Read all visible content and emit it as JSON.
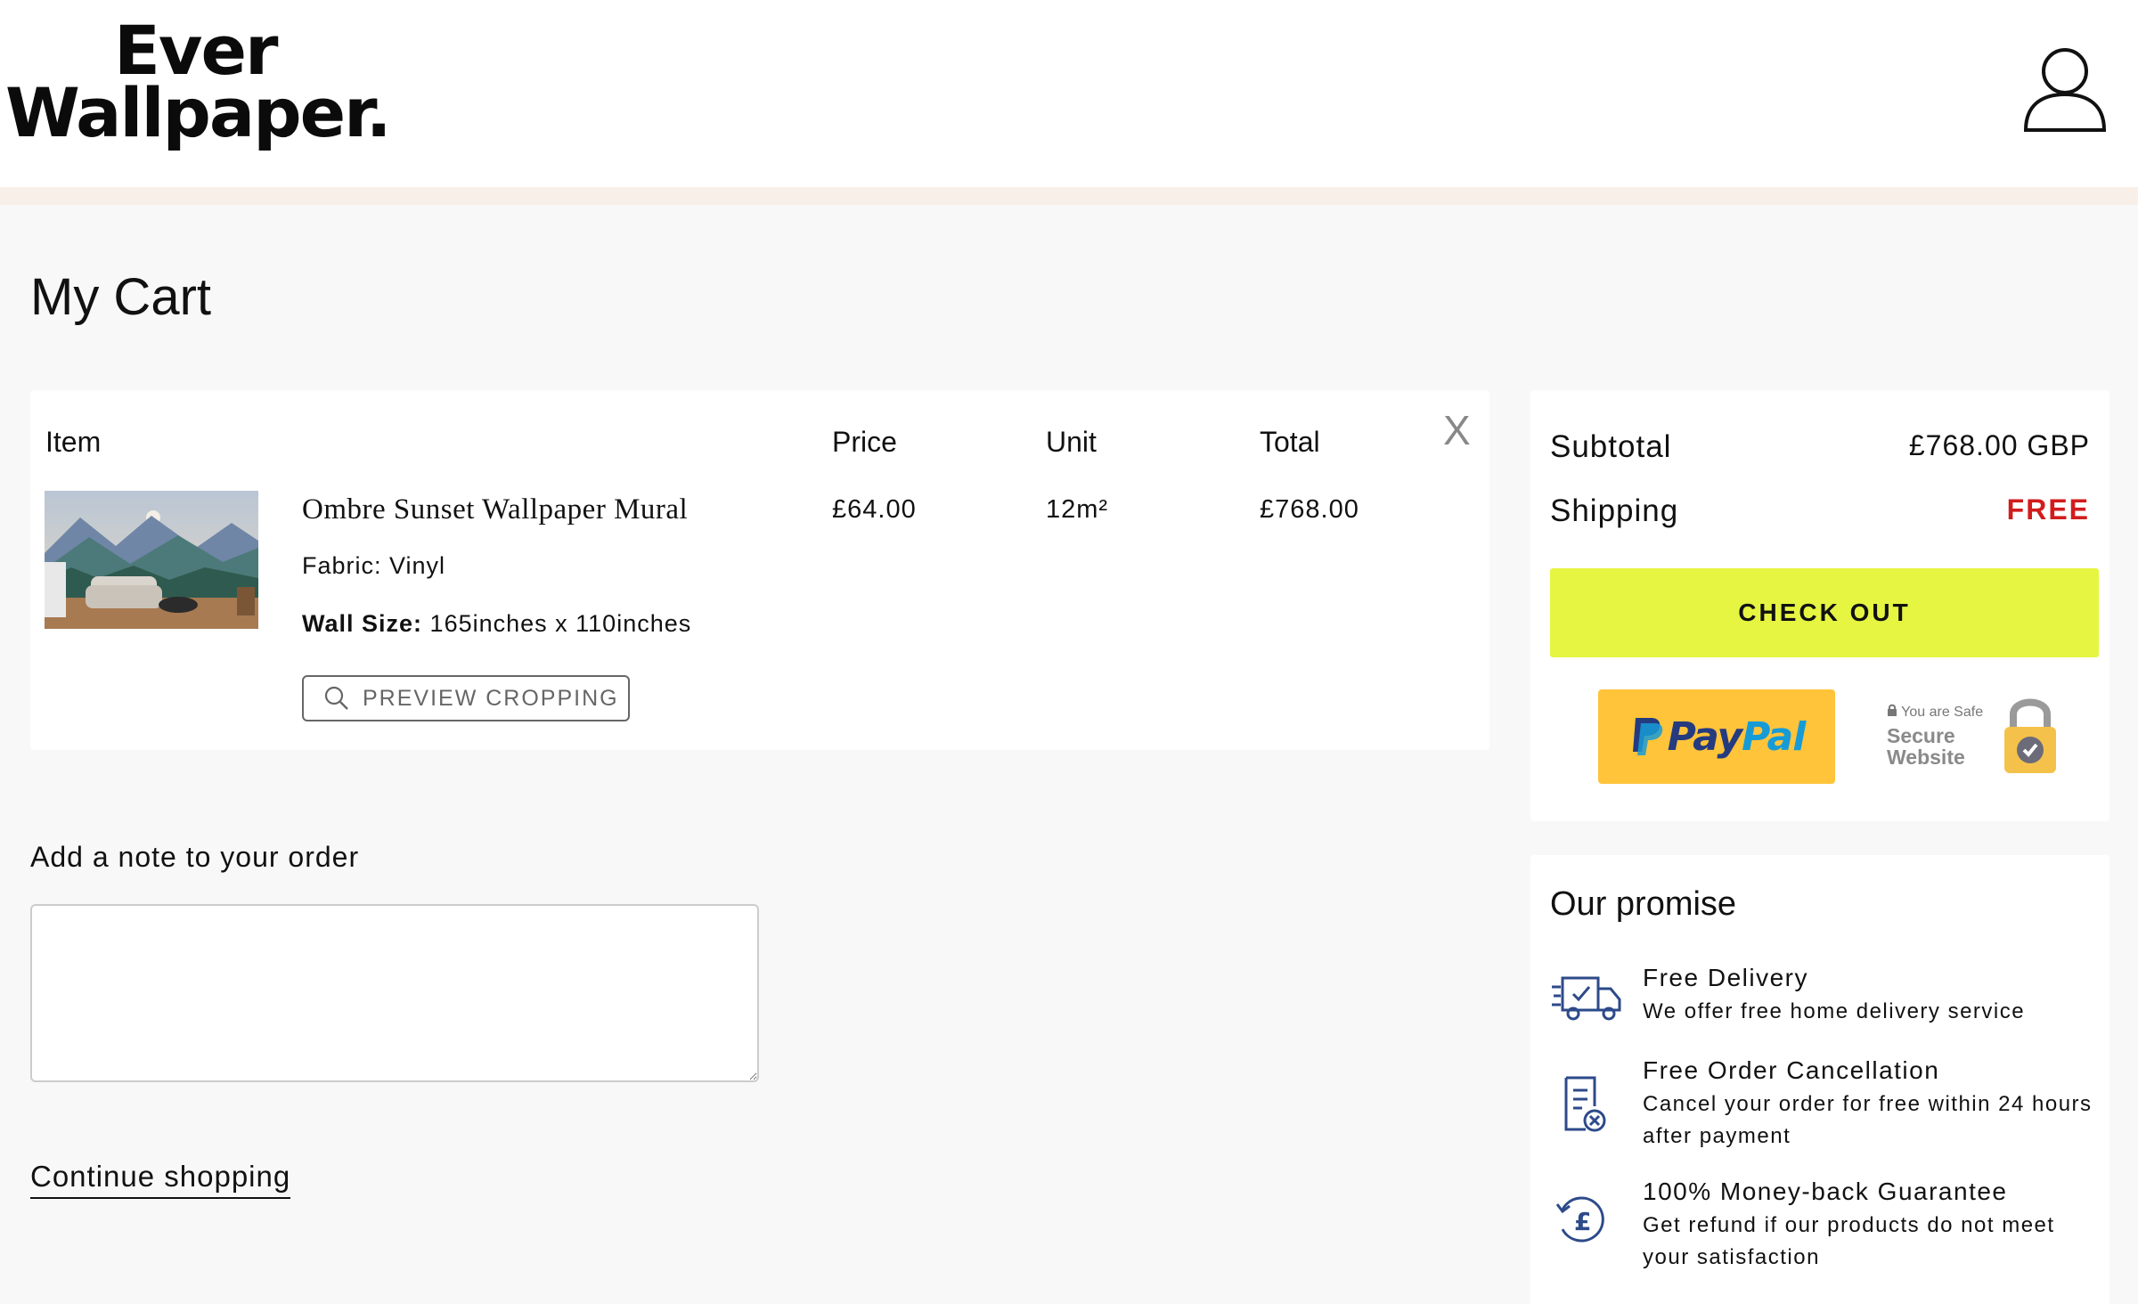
{
  "brand": {
    "line1": "Ever",
    "line2": "Wallpaper."
  },
  "page_title": "My Cart",
  "cart": {
    "headers": {
      "item": "Item",
      "price": "Price",
      "unit": "Unit",
      "total": "Total"
    },
    "remove_label": "X",
    "item": {
      "name": "Ombre Sunset Wallpaper Mural",
      "fabric": "Fabric: Vinyl",
      "size_label": "Wall Size:",
      "size_value": "165inches x 110inches",
      "preview_label": "PREVIEW CROPPING",
      "price": "£64.00",
      "unit": "12m²",
      "total": "£768.00"
    }
  },
  "note": {
    "label": "Add a note to your order",
    "value": "",
    "placeholder": ""
  },
  "continue_label": "Continue shopping",
  "summary": {
    "subtotal_label": "Subtotal",
    "subtotal_value": "£768.00 GBP",
    "shipping_label": "Shipping",
    "shipping_value": "FREE",
    "checkout_label": "CHECK OUT",
    "paypal_pay": "Pay",
    "paypal_pal": "Pal",
    "secure_small": "You are Safe",
    "secure_line1": "Secure",
    "secure_line2": "Website"
  },
  "promise": {
    "title": "Our promise",
    "items": [
      {
        "icon": "delivery-truck-icon",
        "title": "Free Delivery",
        "desc": "We offer free home delivery service"
      },
      {
        "icon": "order-cancel-icon",
        "title": "Free Order Cancellation",
        "desc": "Cancel your order for free within 24 hours after payment"
      },
      {
        "icon": "money-back-icon",
        "title": "100% Money-back Guarantee",
        "desc": "Get refund if our products do not meet your satisfaction"
      }
    ]
  },
  "colors": {
    "checkout_bg": "#e6f542",
    "free": "#d21c1c",
    "promo_strip": "#f8efe8",
    "icon_blue": "#2d4a8a"
  }
}
